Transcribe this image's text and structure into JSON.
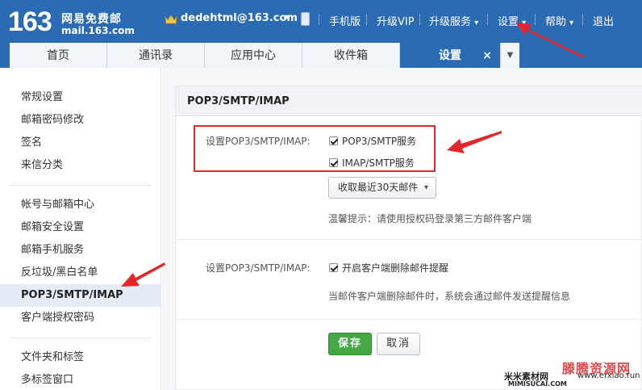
{
  "header": {
    "logo_number": "163",
    "logo_name": "网易免费邮",
    "logo_domain": "mail.163.com",
    "user_email": "dedehtml@163.com",
    "nav": [
      "手机版",
      "升级VIP",
      "升级服务",
      "设置",
      "帮助",
      "退出"
    ]
  },
  "tabs": {
    "items": [
      "首页",
      "通讯录",
      "应用中心",
      "收件箱",
      "设置"
    ],
    "close_glyph": "×"
  },
  "sidebar": {
    "group1": [
      "常规设置",
      "邮箱密码修改",
      "签名",
      "来信分类"
    ],
    "group2": [
      "帐号与邮箱中心",
      "邮箱安全设置",
      "邮箱手机服务",
      "反垃圾/黑白名单",
      "POP3/SMTP/IMAP",
      "客户端授权密码"
    ],
    "group3": [
      "文件夹和标签",
      "多标签窗口"
    ],
    "active": "POP3/SMTP/IMAP"
  },
  "panel": {
    "title": "POP3/SMTP/IMAP",
    "row1": {
      "label": "设置POP3/SMTP/IMAP:",
      "option1": "POP3/SMTP服务",
      "option2": "IMAP/SMTP服务",
      "select_value": "收取最近30天邮件",
      "hint": "温馨提示：请使用授权码登录第三方邮件客户端"
    },
    "row2": {
      "label": "设置POP3/SMTP/IMAP:",
      "option": "开启客户端删除邮件提醒",
      "hint": "当邮件客户端删除邮件时，系统会通过邮件发送提醒信息"
    },
    "save_label": "保存",
    "cancel_label": "取消"
  },
  "watermark": {
    "line1": "滕腾资源网",
    "line2": "米米素材网",
    "line3": "MIMISUCAI.COM",
    "line4": "www.erxiao.run"
  },
  "colors": {
    "header_blue": "#2b6bb3",
    "annotation_red": "#e3262b",
    "save_green": "#45a845"
  }
}
